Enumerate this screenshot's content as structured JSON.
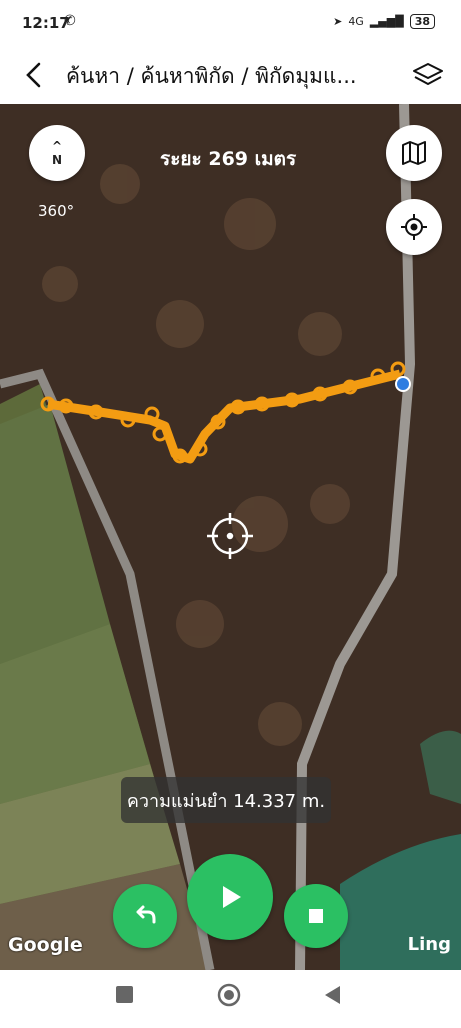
{
  "status_bar": {
    "time": "12:17",
    "battery": "38",
    "network": "4G"
  },
  "app_bar": {
    "title": "ค้นหา / ค้นหาพิกัด / พิกัดมุมแ..."
  },
  "map": {
    "compass_label": "N",
    "heading": "360°",
    "distance": "ระยะ 269 เมตร",
    "accuracy": "ความแม่นยำ 14.337 m.",
    "google_logo": "Google",
    "credit": "Ling",
    "colors": {
      "route": "#f39c12",
      "location": "#2f7de1",
      "accent": "#2bc063"
    }
  },
  "controls": {
    "undo": "undo-icon",
    "play": "play-icon",
    "stop": "stop-icon",
    "map_type": "map-icon",
    "locate": "locate-icon",
    "layers": "layers-icon"
  }
}
